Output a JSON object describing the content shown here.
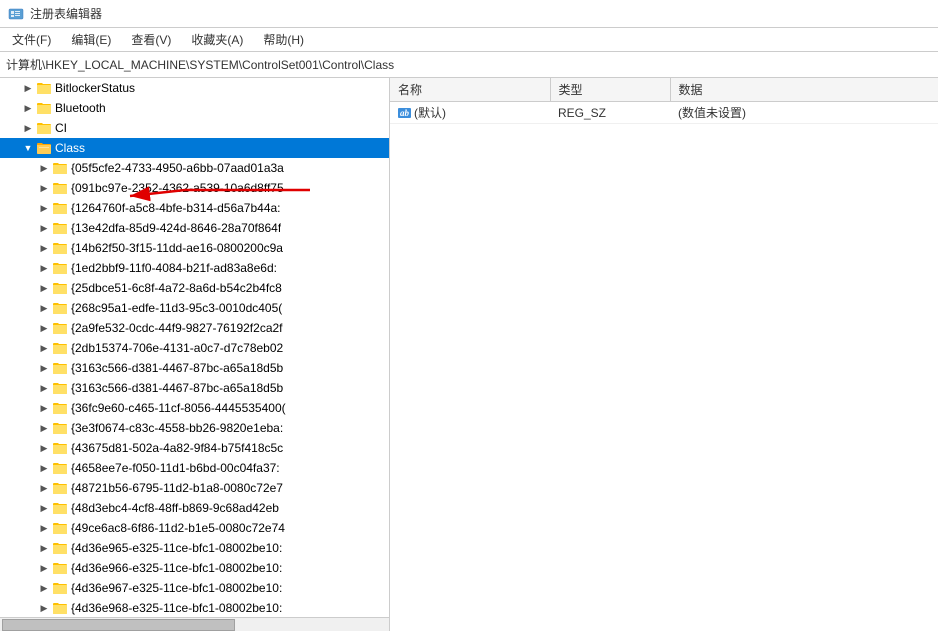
{
  "window": {
    "title": "注册表编辑器",
    "title_icon": "registry"
  },
  "menu": {
    "items": [
      {
        "label": "文件(F)"
      },
      {
        "label": "编辑(E)"
      },
      {
        "label": "查看(V)"
      },
      {
        "label": "收藏夹(A)"
      },
      {
        "label": "帮助(H)"
      }
    ]
  },
  "address_bar": {
    "path": "计算机\\HKEY_LOCAL_MACHINE\\SYSTEM\\ControlSet001\\Control\\Class"
  },
  "tree": {
    "items": [
      {
        "id": "bitlocker",
        "label": "BitlockerStatus",
        "indent": 2,
        "expanded": false,
        "selected": false
      },
      {
        "id": "bluetooth",
        "label": "Bluetooth",
        "indent": 2,
        "expanded": false,
        "selected": false
      },
      {
        "id": "ci",
        "label": "CI",
        "indent": 2,
        "expanded": false,
        "selected": false
      },
      {
        "id": "class",
        "label": "Class",
        "indent": 2,
        "expanded": true,
        "selected": true
      },
      {
        "id": "c1",
        "label": "{05f5cfe2-4733-4950-a6bb-07aad01a3a",
        "indent": 3,
        "expanded": false,
        "selected": false
      },
      {
        "id": "c2",
        "label": "{091bc97e-2352-4362-a539-10a6d8ff75",
        "indent": 3,
        "expanded": false,
        "selected": false
      },
      {
        "id": "c3",
        "label": "{1264760f-a5c8-4bfe-b314-d56a7b44a:",
        "indent": 3,
        "expanded": false,
        "selected": false
      },
      {
        "id": "c4",
        "label": "{13e42dfa-85d9-424d-8646-28a70f864f",
        "indent": 3,
        "expanded": false,
        "selected": false
      },
      {
        "id": "c5",
        "label": "{14b62f50-3f15-11dd-ae16-0800200c9a",
        "indent": 3,
        "expanded": false,
        "selected": false
      },
      {
        "id": "c6",
        "label": "{1ed2bbf9-11f0-4084-b21f-ad83a8e6d:",
        "indent": 3,
        "expanded": false,
        "selected": false
      },
      {
        "id": "c7",
        "label": "{25dbce51-6c8f-4a72-8a6d-b54c2b4fc8",
        "indent": 3,
        "expanded": false,
        "selected": false
      },
      {
        "id": "c8",
        "label": "{268c95a1-edfe-11d3-95c3-0010dc405(",
        "indent": 3,
        "expanded": false,
        "selected": false
      },
      {
        "id": "c9",
        "label": "{2a9fe532-0cdc-44f9-9827-76192f2ca2f",
        "indent": 3,
        "expanded": false,
        "selected": false
      },
      {
        "id": "c10",
        "label": "{2db15374-706e-4131-a0c7-d7c78eb02",
        "indent": 3,
        "expanded": false,
        "selected": false
      },
      {
        "id": "c11",
        "label": "{3163c566-d381-4467-87bc-a65a18d5b",
        "indent": 3,
        "expanded": false,
        "selected": false
      },
      {
        "id": "c12",
        "label": "{3163c566-d381-4467-87bc-a65a18d5b",
        "indent": 3,
        "expanded": false,
        "selected": false
      },
      {
        "id": "c13",
        "label": "{36fc9e60-c465-11cf-8056-4445535400(",
        "indent": 3,
        "expanded": false,
        "selected": false
      },
      {
        "id": "c14",
        "label": "{3e3f0674-c83c-4558-bb26-9820e1eba:",
        "indent": 3,
        "expanded": false,
        "selected": false
      },
      {
        "id": "c15",
        "label": "{43675d81-502a-4a82-9f84-b75f418c5c",
        "indent": 3,
        "expanded": false,
        "selected": false
      },
      {
        "id": "c16",
        "label": "{4658ee7e-f050-11d1-b6bd-00c04fa37:",
        "indent": 3,
        "expanded": false,
        "selected": false
      },
      {
        "id": "c17",
        "label": "{48721b56-6795-11d2-b1a8-0080c72e7",
        "indent": 3,
        "expanded": false,
        "selected": false
      },
      {
        "id": "c18",
        "label": "{48d3ebc4-4cf8-48ff-b869-9c68ad42eb",
        "indent": 3,
        "expanded": false,
        "selected": false
      },
      {
        "id": "c19",
        "label": "{49ce6ac8-6f86-11d2-b1e5-0080c72e74",
        "indent": 3,
        "expanded": false,
        "selected": false
      },
      {
        "id": "c20",
        "label": "{4d36e965-e325-11ce-bfc1-08002be10:",
        "indent": 3,
        "expanded": false,
        "selected": false
      },
      {
        "id": "c21",
        "label": "{4d36e966-e325-11ce-bfc1-08002be10:",
        "indent": 3,
        "expanded": false,
        "selected": false
      },
      {
        "id": "c22",
        "label": "{4d36e967-e325-11ce-bfc1-08002be10:",
        "indent": 3,
        "expanded": false,
        "selected": false
      },
      {
        "id": "c23",
        "label": "{4d36e968-e325-11ce-bfc1-08002be10:",
        "indent": 3,
        "expanded": false,
        "selected": false
      }
    ]
  },
  "right_panel": {
    "columns": [
      {
        "label": "名称",
        "key": "name"
      },
      {
        "label": "类型",
        "key": "type"
      },
      {
        "label": "数据",
        "key": "data"
      }
    ],
    "rows": [
      {
        "name": "(默认)",
        "type": "REG_SZ",
        "data": "(数值未设置)",
        "icon": "ab"
      }
    ]
  }
}
